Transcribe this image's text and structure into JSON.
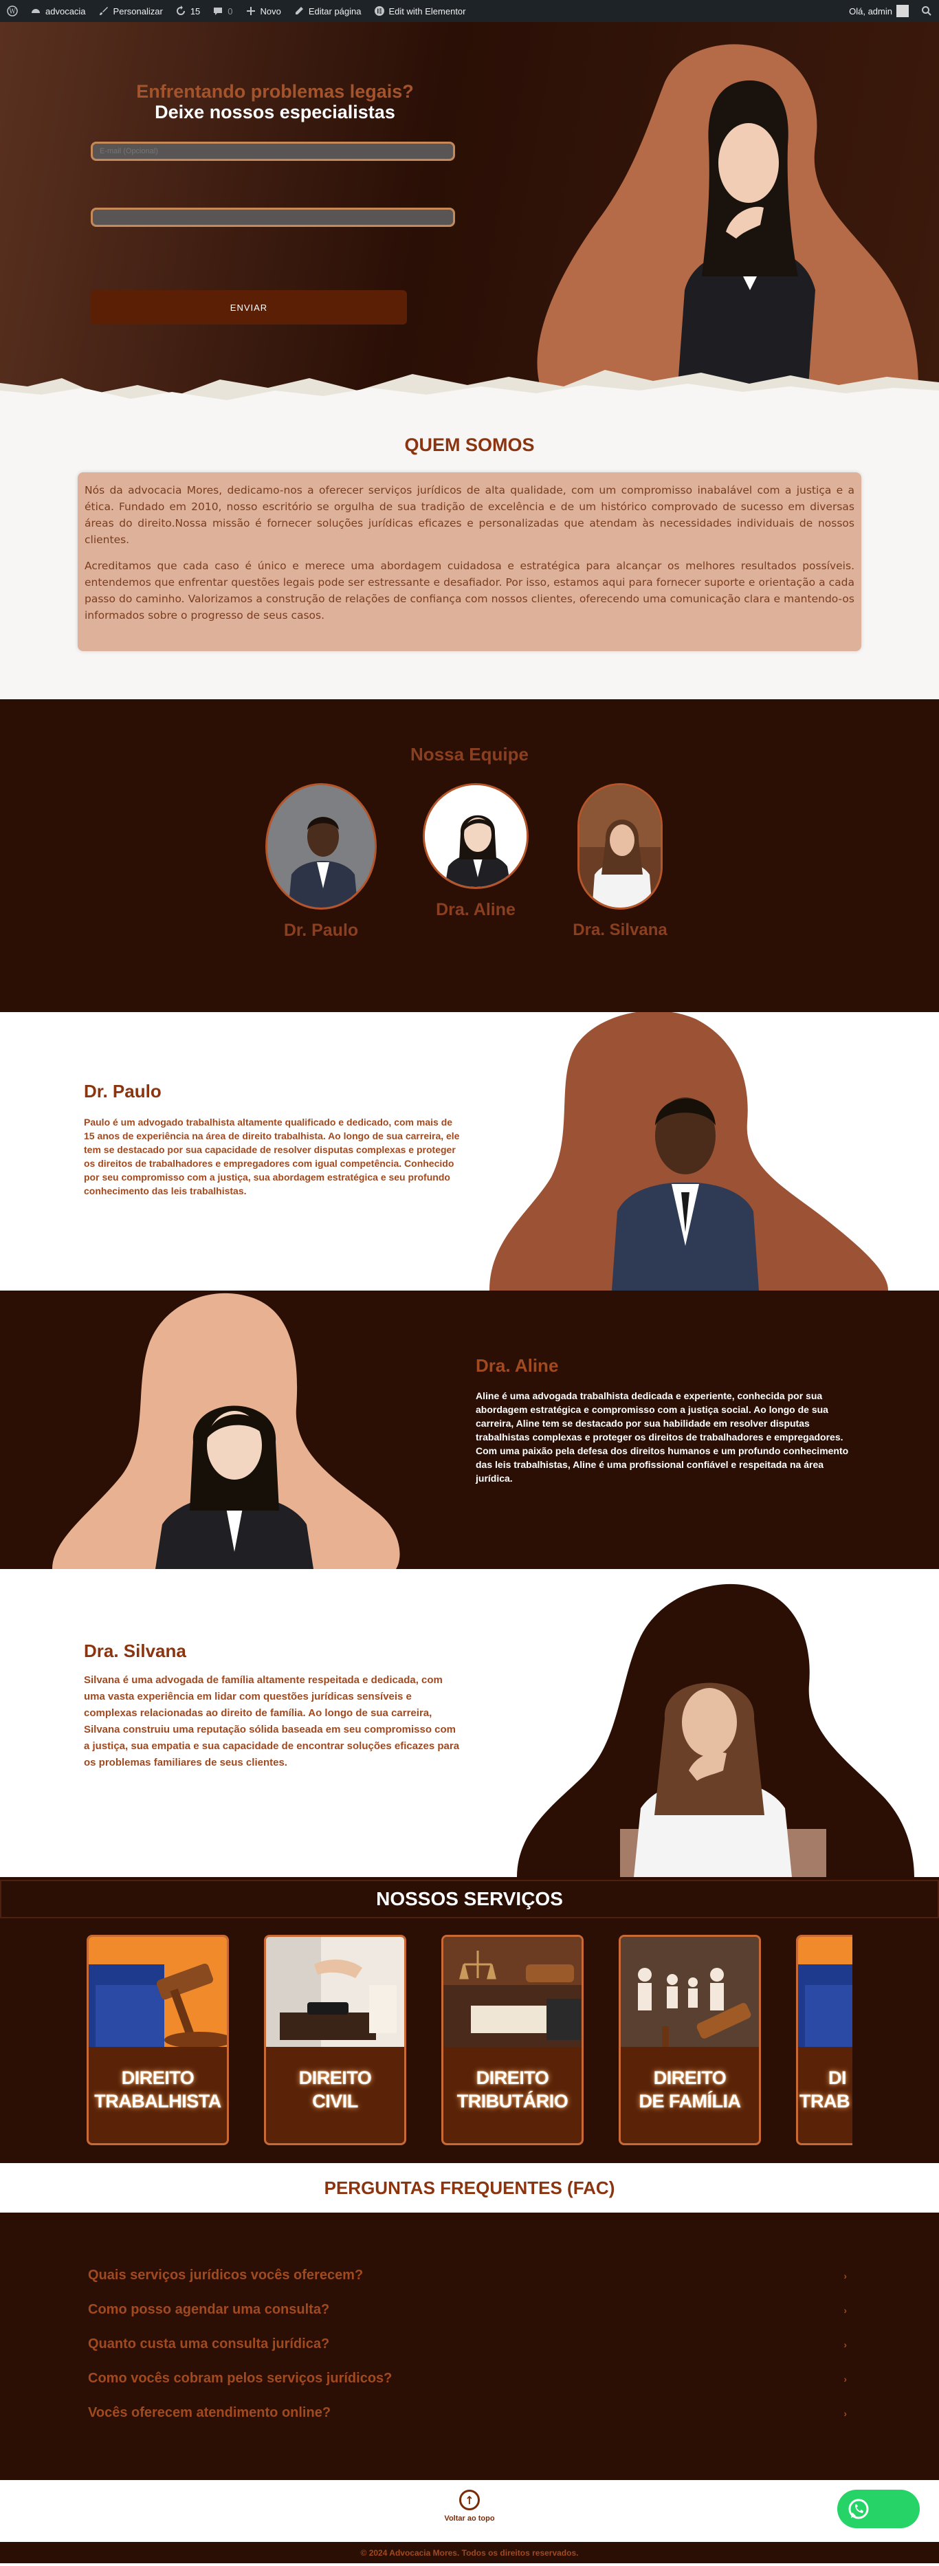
{
  "admin_bar": {
    "site_name": "advocacia",
    "customize": "Personalizar",
    "updates_count": "15",
    "comments_count": "0",
    "new": "Novo",
    "edit_page": "Editar página",
    "elementor": "Edit with Elementor",
    "greeting": "Olá, admin"
  },
  "hero": {
    "title_line1": "Enfrentando problemas legais?",
    "title_line2": "Deixe nossos especialistas",
    "field1_placeholder": "E-mail (Opcional)",
    "field2_placeholder": "",
    "submit_label": "ENVIAR"
  },
  "about": {
    "title": "QUEM SOMOS",
    "paragraphs": [
      "Nós da advocacia Mores, dedicamo-nos a oferecer serviços jurídicos de alta qualidade, com um compromisso inabalável com a justiça e a ética. Fundado em 2010, nosso escritório se orgulha de sua tradição de excelência e de um histórico comprovado de sucesso em diversas áreas do direito.Nossa missão é fornecer soluções jurídicas eficazes e personalizadas que atendam às necessidades individuais de nossos clientes.",
      "Acreditamos que cada caso é único e merece uma abordagem cuidadosa e estratégica para alcançar os melhores resultados possíveis. entendemos que enfrentar questões legais pode ser estressante e desafiador. Por isso, estamos aqui para fornecer suporte e orientação a cada passo do caminho. Valorizamos a construção de relações de confiança com nossos clientes, oferecendo uma comunicação clara e mantendo-os informados sobre o progresso de seus casos."
    ]
  },
  "team": {
    "title": "Nossa Equipe",
    "members": [
      {
        "name": "Dr. Paulo"
      },
      {
        "name": "Dra. Aline"
      },
      {
        "name": "Dra. Silvana"
      }
    ]
  },
  "profiles": {
    "paulo": {
      "name": "Dr. Paulo",
      "bio": "Paulo é um advogado trabalhista altamente qualificado e dedicado, com mais de 15 anos de experiência na área de direito trabalhista. Ao longo de sua carreira, ele tem se destacado por sua capacidade de resolver disputas complexas e proteger os direitos de trabalhadores e empregadores com igual competência. Conhecido por seu compromisso com a justiça, sua abordagem estratégica e seu profundo conhecimento das leis trabalhistas."
    },
    "aline": {
      "name": "Dra. Aline",
      "bio": "Aline é uma advogada trabalhista dedicada e experiente, conhecida por sua abordagem estratégica e compromisso com a justiça social. Ao longo de sua carreira, Aline tem se destacado por sua habilidade em resolver disputas trabalhistas complexas e proteger os direitos de trabalhadores e empregadores. Com uma paixão pela defesa dos direitos humanos e um profundo conhecimento das leis trabalhistas, Aline é uma profissional confiável e respeitada na área jurídica."
    },
    "silvana": {
      "name": "Dra. Silvana",
      "bio": "Silvana é uma advogada de família altamente respeitada e dedicada, com uma vasta experiência em lidar com questões jurídicas sensíveis e complexas relacionadas ao direito de família. Ao longo de sua carreira, Silvana construiu uma reputação sólida baseada em seu compromisso com a justiça, sua empatia e sua capacidade de encontrar soluções eficazes para os problemas familiares de seus clientes."
    }
  },
  "services": {
    "title": "NOSSOS SERVIÇOS",
    "items": [
      {
        "line1": "DIREITO",
        "line2": "TRABALHISTA"
      },
      {
        "line1": "DIREITO",
        "line2": "CIVIL"
      },
      {
        "line1": "DIREITO",
        "line2": "TRIBUTÁRIO"
      },
      {
        "line1": "DIREITO",
        "line2": "DE FAMÍLIA"
      },
      {
        "line1": "DI",
        "line2": "TRAB"
      }
    ]
  },
  "faq": {
    "title": "PERGUNTAS FREQUENTES (FAC)",
    "questions": [
      "Quais serviços jurídicos vocês oferecem?",
      "Como posso agendar uma consulta?",
      "Quanto custa uma consulta jurídica?",
      "Como vocês cobram pelos serviços jurídicos?",
      "Vocês oferecem atendimento online?"
    ]
  },
  "footer": {
    "back_to_top": "Voltar ao topo",
    "copyright": "© 2024 Advocacia Mores. Todos os direitos reservados."
  },
  "colors": {
    "brand_dark": "#2b0e04",
    "brand_accent": "#a14a20",
    "blob_tan": "#e8b292",
    "whatsapp": "#25d366"
  }
}
